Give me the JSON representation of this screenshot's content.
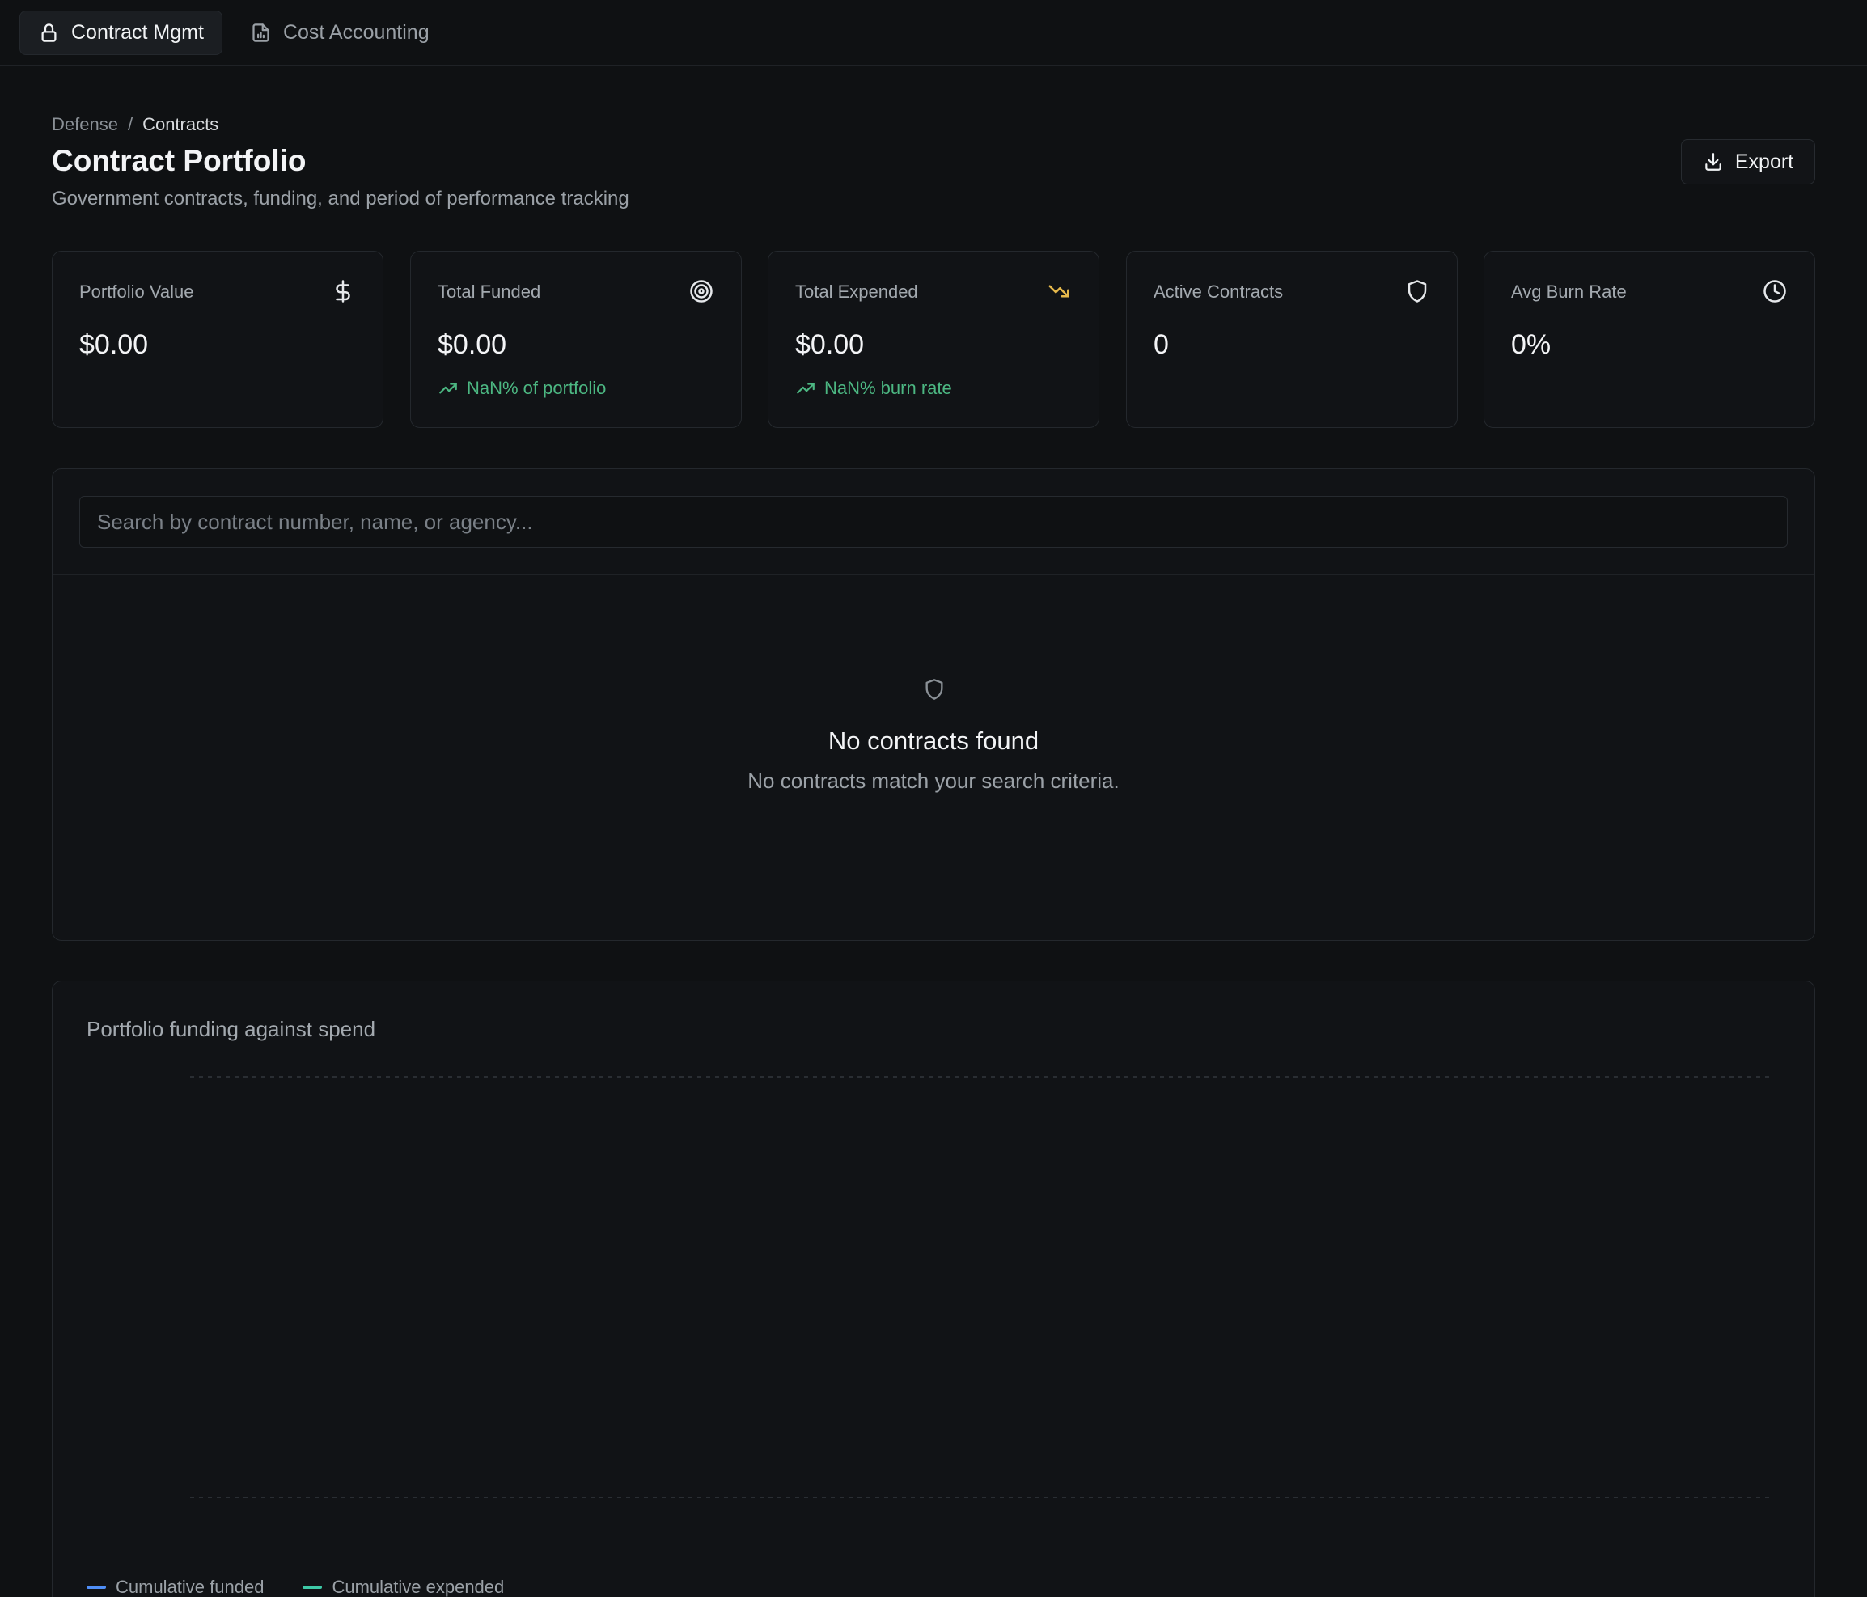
{
  "tabs": [
    {
      "label": "Contract Mgmt",
      "icon": "lock-icon",
      "active": true
    },
    {
      "label": "Cost Accounting",
      "icon": "file-chart-icon",
      "active": false
    }
  ],
  "breadcrumb": {
    "parent": "Defense",
    "separator": "/",
    "current": "Contracts"
  },
  "header": {
    "title": "Contract Portfolio",
    "subtitle": "Government contracts, funding, and period of performance tracking",
    "export_label": "Export"
  },
  "stats": [
    {
      "label": "Portfolio Value",
      "value": "$0.00",
      "icon": "dollar-icon",
      "trend": ""
    },
    {
      "label": "Total Funded",
      "value": "$0.00",
      "icon": "target-icon",
      "trend": "NaN% of portfolio"
    },
    {
      "label": "Total Expended",
      "value": "$0.00",
      "icon": "trending-down-icon",
      "trend": "NaN% burn rate"
    },
    {
      "label": "Active Contracts",
      "value": "0",
      "icon": "shield-icon",
      "trend": ""
    },
    {
      "label": "Avg Burn Rate",
      "value": "0%",
      "icon": "clock-icon",
      "trend": ""
    }
  ],
  "search": {
    "placeholder": "Search by contract number, name, or agency...",
    "value": ""
  },
  "empty_state": {
    "title": "No contracts found",
    "message": "No contracts match your search criteria."
  },
  "colors": {
    "background": "#0f1113",
    "positive": "#4cb782",
    "warning": "#e5b84b",
    "funded": "#4f8ef7",
    "expended": "#3ec9a7"
  },
  "chart_data": {
    "type": "line",
    "title": "Portfolio funding against spend",
    "series": [
      {
        "name": "Cumulative funded",
        "values": []
      },
      {
        "name": "Cumulative expended",
        "values": []
      }
    ],
    "grid": true,
    "legend": "bottom-left"
  }
}
